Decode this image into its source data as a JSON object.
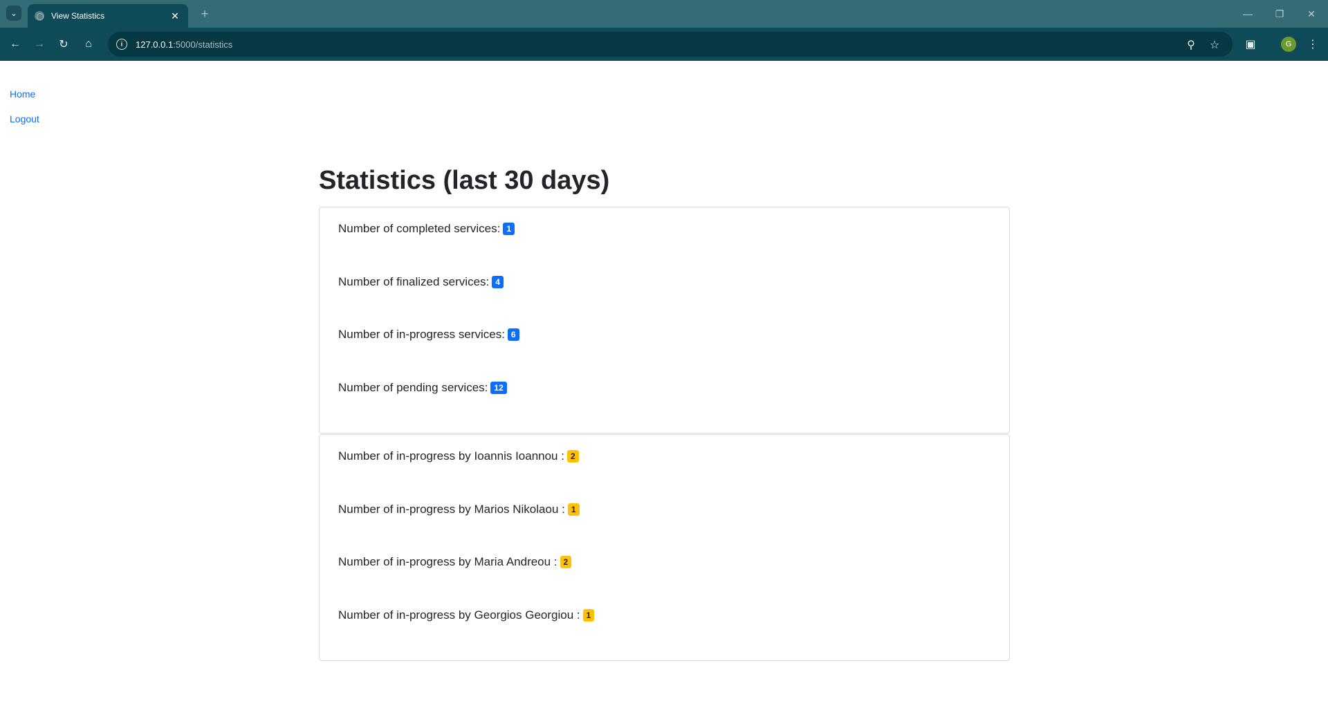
{
  "browser": {
    "tab_title": "View Statistics",
    "url_host": "127.0.0.1",
    "url_path": ":5000/statistics",
    "profile_initial": "G"
  },
  "nav": {
    "home": "Home",
    "logout": "Logout"
  },
  "page": {
    "title": "Statistics (last 30 days)"
  },
  "service_stats": [
    {
      "label": "Number of completed services:",
      "value": "1"
    },
    {
      "label": "Number of finalized services:",
      "value": "4"
    },
    {
      "label": "Number of in-progress services:",
      "value": "6"
    },
    {
      "label": "Number of pending services:",
      "value": "12"
    }
  ],
  "technician_stats": [
    {
      "label": "Number of in-progress by Ioannis Ioannou :",
      "value": "2"
    },
    {
      "label": "Number of in-progress by Marios Nikolaou :",
      "value": "1"
    },
    {
      "label": "Number of in-progress by Maria Andreou :",
      "value": "2"
    },
    {
      "label": "Number of in-progress by Georgios Georgiou :",
      "value": "1"
    }
  ],
  "colors": {
    "badge_primary": "#0d6efd",
    "badge_warning": "#ffc107",
    "link": "#0d6efd",
    "toolbar": "#0e4a57"
  }
}
